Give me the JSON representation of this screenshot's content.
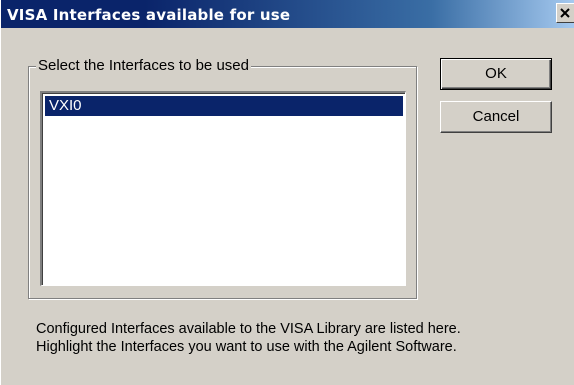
{
  "window": {
    "title": "VISA Interfaces available for use",
    "close_glyph": "×",
    "close_icon": "close-icon"
  },
  "group": {
    "label": "Select the Interfaces to be used"
  },
  "listbox": {
    "items": [
      {
        "label": "VXI0",
        "selected": true
      }
    ]
  },
  "buttons": {
    "ok_label": "OK",
    "cancel_label": "Cancel"
  },
  "description": {
    "line1": "Configured Interfaces available to the VISA Library are listed here.",
    "line2": "Highlight the Interfaces you want to use with the Agilent Software."
  },
  "colors": {
    "titlebar_start": "#0a246a",
    "titlebar_end": "#a6caf0",
    "selection": "#0a246a",
    "face": "#d4d0c8"
  }
}
